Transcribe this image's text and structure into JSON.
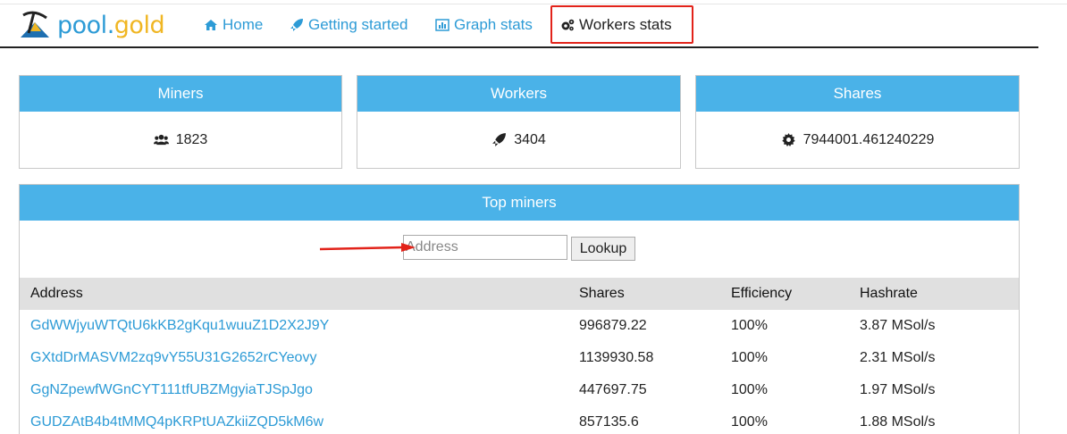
{
  "brand": {
    "name_part1": "pool",
    "name_dot": ".",
    "name_part2": "gold"
  },
  "nav": {
    "home": "Home",
    "getting_started": "Getting started",
    "graph_stats": "Graph stats",
    "workers_stats": "Workers stats"
  },
  "stats": {
    "miners": {
      "label": "Miners",
      "value": "1823",
      "icon": "users-icon"
    },
    "workers": {
      "label": "Workers",
      "value": "3404",
      "icon": "rocket-icon"
    },
    "shares": {
      "label": "Shares",
      "value": "7944001.461240229",
      "icon": "gear-icon"
    }
  },
  "top_miners": {
    "title": "Top miners",
    "search": {
      "placeholder": "Address",
      "value": "",
      "button": "Lookup"
    },
    "columns": [
      "Address",
      "Shares",
      "Efficiency",
      "Hashrate"
    ],
    "rows": [
      [
        "GdWWjyuWTQtU6kKB2gKqu1wuuZ1D2X2J9Y",
        "996879.22",
        "100%",
        "3.87 MSol/s"
      ],
      [
        "GXtdDrMASVM2zq9vY55U31G2652rCYeovy",
        "1139930.58",
        "100%",
        "2.31 MSol/s"
      ],
      [
        "GgNZpewfWGnCYT111tfUBZMgyiaTJSpJgo",
        "447697.75",
        "100%",
        "1.97 MSol/s"
      ],
      [
        "GUDZAtB4b4tMMQ4pKRPtUAZkiiZQD5kM6w",
        "857135.6",
        "100%",
        "1.88 MSol/s"
      ]
    ]
  },
  "colors": {
    "accent": "#4ab2e8",
    "link": "#2d9bd6",
    "gold": "#f0b623",
    "annotation": "#e2231a"
  }
}
